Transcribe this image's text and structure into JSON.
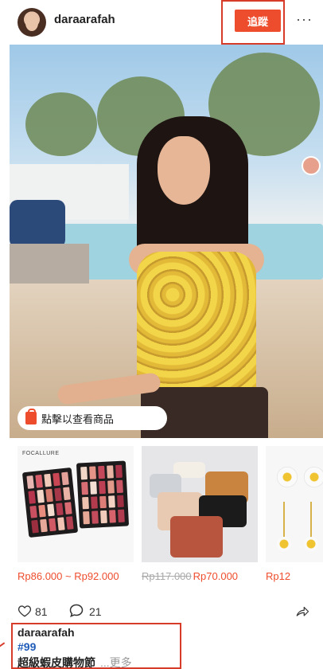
{
  "header": {
    "username": "daraarafah",
    "follow_label": "追蹤",
    "more_icon": "more-horizontal-icon"
  },
  "post": {
    "tap_to_view_label": "點擊以查看商品"
  },
  "products": [
    {
      "price": "Rp86.000 ~ Rp92.000",
      "brand": "FOCALLURE"
    },
    {
      "old_price": "Rp117.000",
      "price": "Rp70.000"
    },
    {
      "price": "Rp12"
    }
  ],
  "actions": {
    "likes": "81",
    "comments": "21"
  },
  "caption": {
    "username": "daraarafah",
    "hashtag": "#99",
    "text": "超級蝦皮購物節",
    "more_label": "...更多"
  },
  "colors": {
    "accent": "#ee4d2d",
    "hashtag": "#1e5bb8",
    "highlight_border": "#d93b2b"
  }
}
